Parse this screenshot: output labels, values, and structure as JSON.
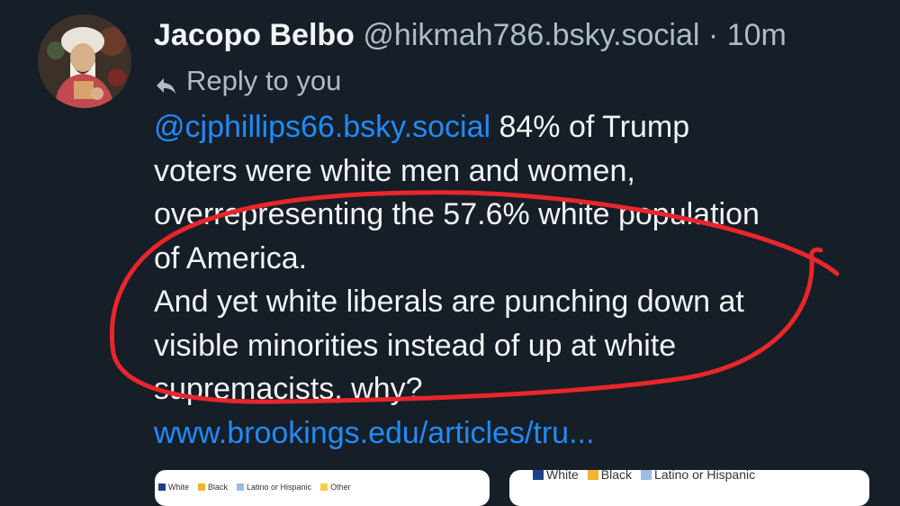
{
  "post": {
    "author_name": "Jacopo Belbo",
    "handle": "@hikmah786.bsky.social",
    "separator": "·",
    "time": "10m",
    "reply_label": "Reply to you",
    "mention": "@cjphillips66.bsky.social",
    "lines": [
      " 84% of Trump",
      "voters were white men and women,",
      "overrepresenting the 57.6% white population",
      "of America.",
      "And yet white liberals are punching down at",
      "visible minorities instead of up at white",
      "supremacists, why?"
    ],
    "link": "www.brookings.edu/articles/tru..."
  },
  "icons": {
    "avatar": "avatar-portrait",
    "reply": "reply-arrow-icon"
  },
  "embeds": {
    "left_legend": [
      "White",
      "Black",
      "Latino or Hispanic",
      "Other"
    ],
    "right_legend": [
      "White",
      "Black",
      "Latino or Hispanic"
    ],
    "legend_colors": [
      "#1f3f8a",
      "#f2b233",
      "#9bbde0",
      "#f4d03f"
    ]
  },
  "colors": {
    "background": "#161e27",
    "text": "#f1f3f5",
    "muted": "#aebbc9",
    "link": "#208bfe",
    "annotation": "#e8262b"
  }
}
